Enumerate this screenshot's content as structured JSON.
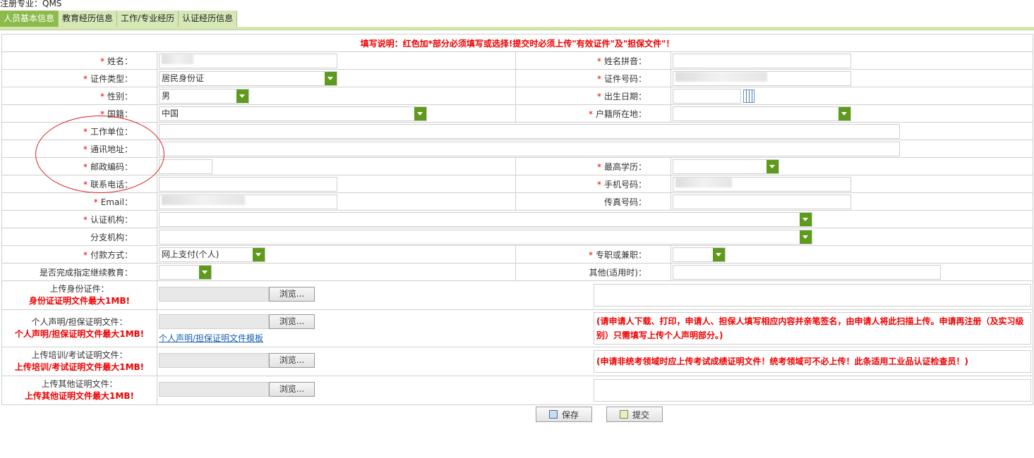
{
  "header": {
    "registered_major": "注册专业：QMS"
  },
  "tabs": [
    "人员基本信息",
    "教育经历信息",
    "工作/专业经历",
    "认证经历信息"
  ],
  "note": "填写说明：红色加*部分必须填写或选择!提交时必须上传\"有效证件\"及\"担保文件\"！",
  "fields": {
    "name": {
      "label": "姓名：",
      "value": ""
    },
    "pinyin": {
      "label": "姓名拼音：",
      "value": ""
    },
    "id_type": {
      "label": "证件类型：",
      "value": "居民身份证"
    },
    "id_no": {
      "label": "证件号码：",
      "value": ""
    },
    "gender": {
      "label": "性别：",
      "value": "男"
    },
    "birth": {
      "label": "出生日期：",
      "value": ""
    },
    "nationality": {
      "label": "国籍：",
      "value": "中国"
    },
    "domicile": {
      "label": "户籍所在地：",
      "value": ""
    },
    "employer": {
      "label": "工作单位：",
      "value": ""
    },
    "address": {
      "label": "通讯地址：",
      "value": ""
    },
    "postcode": {
      "label": "邮政编码：",
      "value": ""
    },
    "education": {
      "label": "最高学历：",
      "value": ""
    },
    "phone": {
      "label": "联系电话：",
      "value": ""
    },
    "mobile": {
      "label": "手机号码：",
      "value": ""
    },
    "email": {
      "label": "Email：",
      "value": ""
    },
    "fax": {
      "label": "传真号码：",
      "value": ""
    },
    "cert_body": {
      "label": "认证机构：",
      "value": ""
    },
    "branch": {
      "label": "分支机构：",
      "value": ""
    },
    "payment": {
      "label": "付款方式：",
      "value": "网上支付(个人)"
    },
    "fulltime": {
      "label": "专职或兼职：",
      "value": ""
    },
    "cont_edu": {
      "label": "是否完成指定继续教育：",
      "value": ""
    },
    "other": {
      "label": "其他(适用时)：",
      "value": ""
    }
  },
  "uploads": [
    {
      "label": "上传身份证件：",
      "limit": "身份证证明文件最大1MB!",
      "button": "浏览...",
      "note": "",
      "link": ""
    },
    {
      "label": "个人声明/担保证明文件：",
      "limit": "个人声明/担保证明文件最大1MB!",
      "button": "浏览...",
      "note": "(请申请人下载、打印，申请人、担保人填写相应内容并亲笔签名，由申请人将此扫描上传。申请再注册（及实习级别）只需填写上传个人声明部分。)",
      "link": "个人声明/担保证明文件模板"
    },
    {
      "label": "上传培训/考试证明文件：",
      "limit": "上传培训/考试证明文件最大1MB!",
      "button": "浏览...",
      "note": "(申请非统考领域时应上传考试成绩证明文件！统考领域可不必上传！此条适用工业品认证检查员！)",
      "link": ""
    },
    {
      "label": "上传其他证明文件：",
      "limit": "上传其他证明文件最大1MB!",
      "button": "浏览...",
      "note": "",
      "link": ""
    }
  ],
  "actions": {
    "save": "保存",
    "submit": "提交"
  },
  "colors": {
    "accent": "#5e9a1c",
    "required": "#e00000",
    "tab_active": "#8cbb4c"
  }
}
